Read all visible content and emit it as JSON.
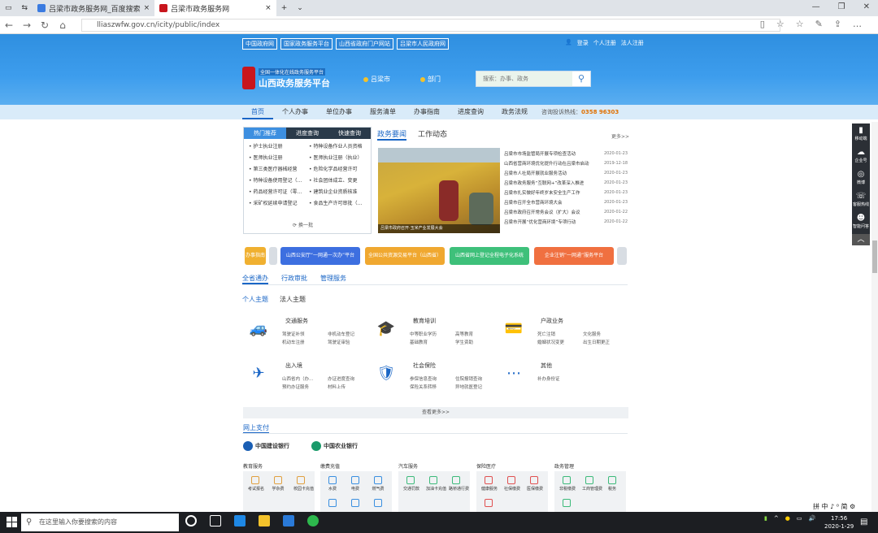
{
  "browser": {
    "tabs": [
      {
        "label": "吕梁市政务服务网_百度搜索"
      },
      {
        "label": "吕梁市政务服务网"
      }
    ],
    "url": "lliaszwfw.gov.cn/icity/public/index"
  },
  "header": {
    "toplinks": [
      "中国政府网",
      "国家政务服务平台",
      "山西省政府门户网站",
      "吕梁市人民政府网"
    ],
    "login": "登录",
    "register": "个人注册",
    "legal_register": "法人注册",
    "logo_sub": "全国一体化在线政务服务平台",
    "logo_title": "山西政务服务平台",
    "location": "吕梁市",
    "dept": "部门",
    "search_placeholder": "搜索：办事、政务"
  },
  "nav": {
    "items": [
      "首页",
      "个人办事",
      "单位办事",
      "服务清单",
      "办事指南",
      "进度查询",
      "政务法规"
    ],
    "hotline_label": "咨询投诉热线：",
    "hotline": "0358 96303"
  },
  "left_box": {
    "tabs": [
      "热门推荐",
      "进度查询",
      "快速查询"
    ],
    "items": [
      "护士执业注册",
      "特种设备作业人员资格",
      "医师执业注册",
      "医师执业注册（执业）",
      "第三类医疗器械经营",
      "危险化学品经营许可",
      "特种设备使用登记（…",
      "社会团体成立、变更",
      "药品经营许可证（零…",
      "建筑业企业资质核准",
      "采矿权延续申请登记",
      "食品生产许可审批（…"
    ],
    "refresh": "换一批"
  },
  "news": {
    "tabs": [
      "政务要闻",
      "工作动态"
    ],
    "more": "更多>>",
    "photo_caption": "吕梁市政府召开·玉米产业发展大会",
    "items": [
      {
        "title": "吕梁市市场监管局开展专项检查活动",
        "date": "2020-01-23"
      },
      {
        "title": "山西省营商环境优化提升行动在吕梁市启动",
        "date": "2019-12-18"
      },
      {
        "title": "吕梁市人社局开展就业服务活动",
        "date": "2020-01-23"
      },
      {
        "title": "吕梁市政务服务“互联网+”改革深入推进",
        "date": "2020-01-23"
      },
      {
        "title": "吕梁市扎实做好年终岁末安全生产工作",
        "date": "2020-01-23"
      },
      {
        "title": "吕梁市召开全市营商环境大会",
        "date": "2020-01-23"
      },
      {
        "title": "吕梁市政府召开常务会议（扩大）会议",
        "date": "2020-01-22"
      },
      {
        "title": "吕梁市开展“优化营商环境”专项行动",
        "date": "2020-01-22"
      }
    ]
  },
  "promo": {
    "b0": "办事指南",
    "b1": "山西公安厅“一网通一次办”平台",
    "b2": "全国公共资源交易平台（山西省）",
    "b3": "山西省网上登记全程电子化系统",
    "b4": "企业注销“一网通”服务平台"
  },
  "service": {
    "tabs": [
      "全省通办",
      "行政审批",
      "管理服务"
    ],
    "ptabs": [
      "个人主题",
      "法人主题"
    ],
    "cards": [
      {
        "icon": "car-icon",
        "title": "交通服务",
        "subs": [
          "驾驶证补领",
          "非机动车登记",
          "机动车注册",
          "驾驶证审验"
        ]
      },
      {
        "icon": "graduation-cap-icon",
        "title": "教育培训",
        "subs": [
          "中等职业学历",
          "高等教育",
          "基础教育",
          "学生资助"
        ]
      },
      {
        "icon": "id-card-icon",
        "title": "户政业务",
        "subs": [
          "死亡注销",
          "文化服务",
          "婚姻状况变更",
          "出生日期更正"
        ]
      },
      {
        "icon": "plane-icon",
        "title": "出入境",
        "subs": [
          "山西省内（办…",
          "办证进度查询",
          "预约办证服务",
          "材料上传"
        ]
      },
      {
        "icon": "insurance-icon",
        "title": "社会保险",
        "subs": [
          "参保信息查询",
          "住院报销查询",
          "保险关系转移",
          "异地就医登记"
        ]
      },
      {
        "icon": "ellipsis-icon",
        "title": "其他",
        "subs": [
          "补办身份证"
        ]
      }
    ],
    "more": "查看更多>>"
  },
  "payment": {
    "title": "网上支付",
    "banks": [
      "中国建设银行",
      "中国农业银行"
    ],
    "categories": [
      {
        "name": "教育服务",
        "items": [
          "考试报名",
          "学杂费",
          "校园卡充值"
        ]
      },
      {
        "name": "缴费充值",
        "items": [
          "水费",
          "电费",
          "燃气费"
        ]
      },
      {
        "name": "汽车服务",
        "items": [
          "交通罚款",
          "加油卡充值",
          "路桥通行费"
        ]
      },
      {
        "name": "保险医疗",
        "items": [
          "健康服务",
          "社保缴费",
          "医保缴费"
        ]
      },
      {
        "name": "政务管理",
        "items": [
          "非税缴费",
          "工商管理费",
          "税务"
        ]
      }
    ]
  },
  "float_bar": [
    "移动端",
    "企业号",
    "微博",
    "客服热线",
    "智能问答"
  ],
  "taskbar": {
    "search": "在这里输入你要搜索的内容",
    "time": "17:56",
    "date": "2020-1-29",
    "ime": "拼 中 ♪ ⁰ 简 ⚙"
  }
}
